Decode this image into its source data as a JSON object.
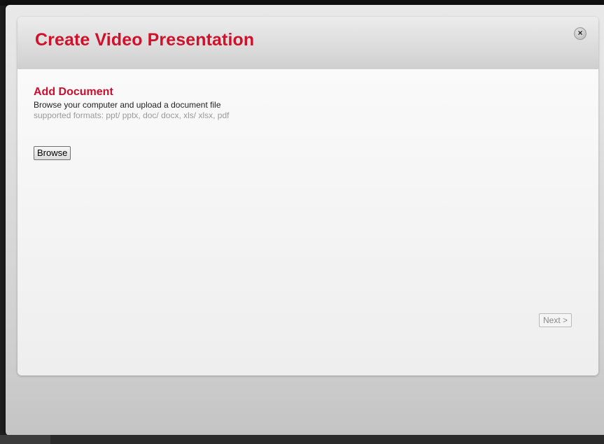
{
  "dialog": {
    "title": "Create Video Presentation",
    "close_icon": "close-icon",
    "close_glyph": "×"
  },
  "section": {
    "title": "Add Document",
    "description": "Browse your computer and upload a document file",
    "formats": "supported formats: ppt/ pptx, doc/ docx, xls/ xlsx, pdf"
  },
  "actions": {
    "browse_label": "Browse",
    "next_label": "Next >"
  },
  "colors": {
    "accent_red": "#d0112b"
  }
}
